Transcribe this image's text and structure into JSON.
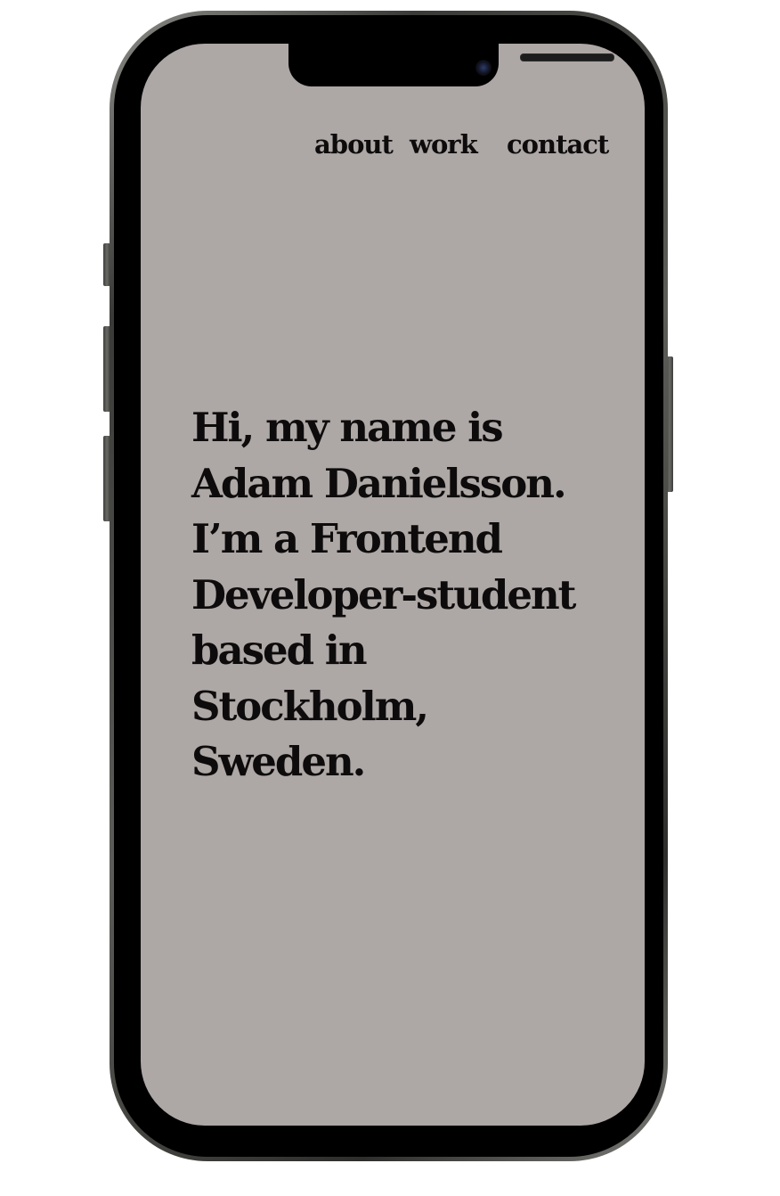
{
  "nav": {
    "items": [
      {
        "label": "about"
      },
      {
        "label": "work"
      },
      {
        "label": "contact"
      }
    ]
  },
  "hero": {
    "text": "Hi, my name is Adam Danielsson. I’m a Frontend Developer-student based in Stockholm, Sweden."
  },
  "colors": {
    "screen_background": "#ada7a6",
    "text": "#0d0b0b",
    "bezel": "#000000"
  }
}
